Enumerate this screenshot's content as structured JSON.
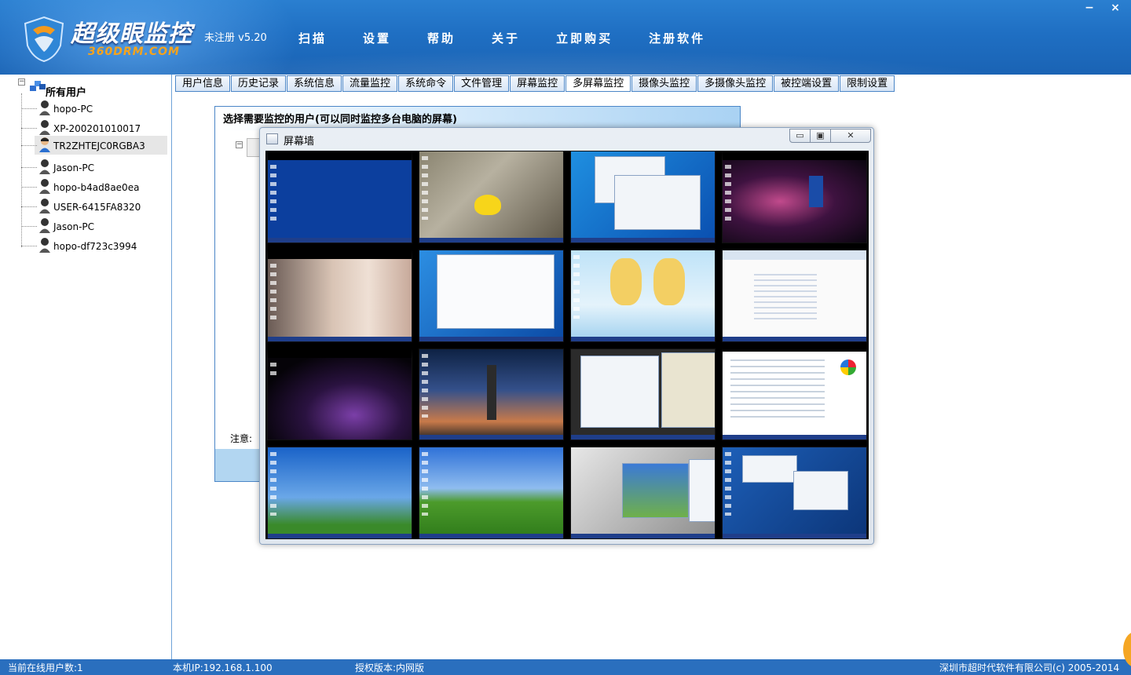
{
  "app": {
    "title": "超级眼监控",
    "domain": "360DRM.COM",
    "version": "未注册 v5.20",
    "colors": {
      "header": "#1f6fc3",
      "accent": "#f6a31c",
      "tab_border": "#4b86c7"
    }
  },
  "main_menu": [
    "扫描",
    "设置",
    "帮助",
    "关于",
    "立即购买",
    "注册软件"
  ],
  "window_controls": {
    "minimize": "−",
    "close": "×"
  },
  "tree": {
    "root_label": "所有用户",
    "toggle": "−",
    "users": [
      {
        "name": "hopo-PC"
      },
      {
        "name": "XP-200201010017"
      },
      {
        "name": "TR2ZHTEJC0RGBA3",
        "selected": true
      },
      {
        "name": "Jason-PC"
      },
      {
        "name": "hopo-b4ad8ae0ea"
      },
      {
        "name": "USER-6415FA8320"
      },
      {
        "name": "Jason-PC"
      },
      {
        "name": "hopo-df723c3994"
      }
    ]
  },
  "tabs": [
    {
      "label": "用户信息"
    },
    {
      "label": "历史记录"
    },
    {
      "label": "系统信息"
    },
    {
      "label": "流量监控"
    },
    {
      "label": "系统命令"
    },
    {
      "label": "文件管理"
    },
    {
      "label": "屏幕监控"
    },
    {
      "label": "多屏幕监控",
      "active": true
    },
    {
      "label": "摄像头监控"
    },
    {
      "label": "多摄像头监控"
    },
    {
      "label": "被控端设置"
    },
    {
      "label": "限制设置"
    }
  ],
  "select_dialog": {
    "title": "选择需要监控的用户(可以同时监控多台电脑的屏幕)",
    "note": "注意:",
    "toggle": "−"
  },
  "screen_wall": {
    "title": "屏幕墙",
    "buttons": {
      "minimize": "▭",
      "maximize": "▣",
      "close": "✕"
    },
    "thumbnails": [
      "blue-xp-desktop",
      "rubber-duck-wallpaper",
      "win7-dialogs",
      "space-tardis",
      "girl-portrait",
      "win7-devices",
      "anime-wallpaper",
      "browser-page",
      "dark-swirl",
      "lighthouse-sunset",
      "chat-apps",
      "system-properties",
      "bliss-sky",
      "bliss-hill",
      "cartoon-windows",
      "lenovo-desktop"
    ]
  },
  "status_bar": {
    "online": "当前在线用户数:1",
    "ip": "本机IP:192.168.1.100",
    "license": "授权版本:内网版",
    "copyright": "深圳市超时代软件有限公司(c) 2005-2014"
  }
}
